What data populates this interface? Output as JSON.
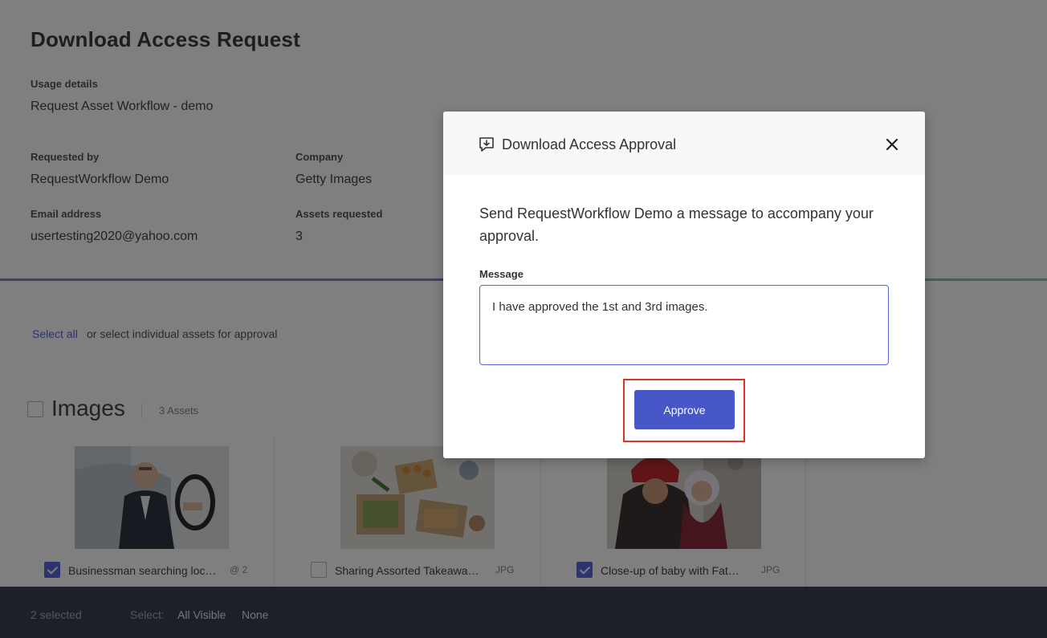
{
  "page": {
    "title": "Download Access Request",
    "usage_label": "Usage details",
    "usage_value": "Request Asset Workflow - demo",
    "requested_by_label": "Requested by",
    "requested_by_value": "RequestWorkflow Demo",
    "company_label": "Company",
    "company_value": "Getty Images",
    "email_label": "Email address",
    "email_value": "usertesting2020@yahoo.com",
    "assets_label": "Assets requested",
    "assets_value": "3",
    "select_all": "Select all",
    "select_hint": "or select individual assets for approval",
    "images_heading": "Images",
    "images_count": "3 Assets"
  },
  "assets": [
    {
      "title": "Businessman searching loc…",
      "meta": "2",
      "checked": true
    },
    {
      "title": "Sharing Assorted Takeawa…",
      "meta": "JPG",
      "checked": false
    },
    {
      "title": "Close-up of baby with Fat…",
      "meta": "JPG",
      "checked": true
    }
  ],
  "bottom_bar": {
    "selected": "2 selected",
    "select_label": "Select:",
    "all_visible": "All Visible",
    "none": "None"
  },
  "modal": {
    "title": "Download Access Approval",
    "body": "Send RequestWorkflow Demo a message to accompany your approval.",
    "message_label": "Message",
    "message_value": "I have approved the 1st and 3rd images.",
    "approve_label": "Approve"
  },
  "colors": {
    "accent": "#4757c7",
    "highlight": "#e0312b",
    "overlay": "rgba(0,0,0,0.5)"
  }
}
